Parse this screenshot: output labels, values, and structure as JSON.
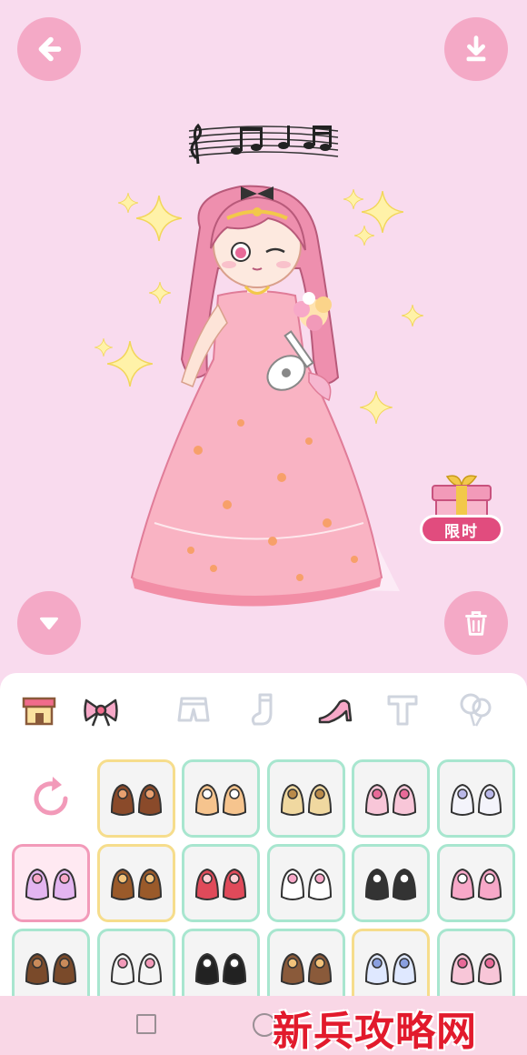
{
  "header": {
    "back_icon": "arrow-left-icon",
    "download_icon": "download-icon"
  },
  "stage": {
    "character": "pink-haired-girl-in-wedding-gown",
    "music_icon": "music-notes-icon",
    "sparkle_icon": "sparkle-icon"
  },
  "promo": {
    "label": "限时",
    "icon": "gift-box-icon"
  },
  "controls": {
    "collapse_icon": "chevron-down-icon",
    "trash_icon": "trash-icon"
  },
  "tabs": [
    {
      "name": "shop",
      "icon": "shop-icon",
      "active": false
    },
    {
      "name": "bow",
      "icon": "bow-icon",
      "active": false
    },
    {
      "name": "shorts",
      "icon": "shorts-icon",
      "active": false
    },
    {
      "name": "socks",
      "icon": "sock-icon",
      "active": false
    },
    {
      "name": "shoes",
      "icon": "high-heel-icon",
      "active": true
    },
    {
      "name": "text",
      "icon": "text-icon",
      "active": false
    },
    {
      "name": "balloons",
      "icon": "balloon-icon",
      "active": false
    }
  ],
  "items": [
    {
      "row": 0,
      "col": 0,
      "type": "reset",
      "icon": "reset-icon"
    },
    {
      "row": 0,
      "col": 1,
      "name": "brown-flower-shoes",
      "frame": "gold",
      "color": "#8a4a2a",
      "accent": "#e8a070"
    },
    {
      "row": 0,
      "col": 2,
      "name": "peach-sandals",
      "frame": "green",
      "color": "#f6c48e",
      "accent": "#ffffff"
    },
    {
      "row": 0,
      "col": 3,
      "name": "tan-sneakers",
      "frame": "green",
      "color": "#f0d8a0",
      "accent": "#b98a4a"
    },
    {
      "row": 0,
      "col": 4,
      "name": "pink-lace-boots",
      "frame": "green",
      "color": "#f8c6d8",
      "accent": "#e86a98"
    },
    {
      "row": 0,
      "col": 5,
      "name": "white-bow-shoes",
      "frame": "green",
      "color": "#f4f4fb",
      "accent": "#b9b7e8"
    },
    {
      "row": 1,
      "col": 0,
      "name": "lilac-fluffy-sandals",
      "frame": "selected",
      "color": "#e3b5f0",
      "accent": "#f7a8c8"
    },
    {
      "row": 1,
      "col": 1,
      "name": "brown-wing-shoes",
      "frame": "gold",
      "color": "#9a5a2a",
      "accent": "#f2c27a"
    },
    {
      "row": 1,
      "col": 2,
      "name": "red-heart-shoes",
      "frame": "green",
      "color": "#e04a5a",
      "accent": "#ffd0d6"
    },
    {
      "row": 1,
      "col": 3,
      "name": "bunny-slippers",
      "frame": "green",
      "color": "#ffffff",
      "accent": "#f7a8c8"
    },
    {
      "row": 1,
      "col": 4,
      "name": "black-sneakers",
      "frame": "green",
      "color": "#333333",
      "accent": "#ffffff"
    },
    {
      "row": 1,
      "col": 5,
      "name": "pink-bunny-shoes",
      "frame": "green",
      "color": "#f7a8c8",
      "accent": "#ffffff"
    },
    {
      "row": 2,
      "col": 0,
      "name": "brown-cat-shoes",
      "frame": "green",
      "color": "#7a4a2a",
      "accent": "#c98a5a"
    },
    {
      "row": 2,
      "col": 1,
      "name": "flower-strap-sandals",
      "frame": "green",
      "color": "#f4f4f4",
      "accent": "#f29ab9"
    },
    {
      "row": 2,
      "col": 2,
      "name": "black-ribbon-heels",
      "frame": "green",
      "color": "#222222",
      "accent": "#ffffff"
    },
    {
      "row": 2,
      "col": 3,
      "name": "bronze-round-shoes",
      "frame": "green",
      "color": "#8a5a3a",
      "accent": "#f2c27a"
    },
    {
      "row": 2,
      "col": 4,
      "name": "crystal-shoes",
      "frame": "gold",
      "color": "#dfe8ff",
      "accent": "#8aa0e0"
    },
    {
      "row": 2,
      "col": 5,
      "name": "pink-ribbon-shoes",
      "frame": "green",
      "color": "#f8c6d8",
      "accent": "#e86a98"
    }
  ],
  "navbar": {
    "recents_icon": "square-icon",
    "home_icon": "circle-icon"
  },
  "watermark": {
    "text": "新兵攻略网"
  },
  "colors": {
    "background": "#f9dbee",
    "button": "#f4a9c6",
    "frame_green": "#a8e6cf",
    "frame_gold": "#f6dd8c",
    "frame_selected": "#f29ab9",
    "promo": "#e14c7e"
  }
}
